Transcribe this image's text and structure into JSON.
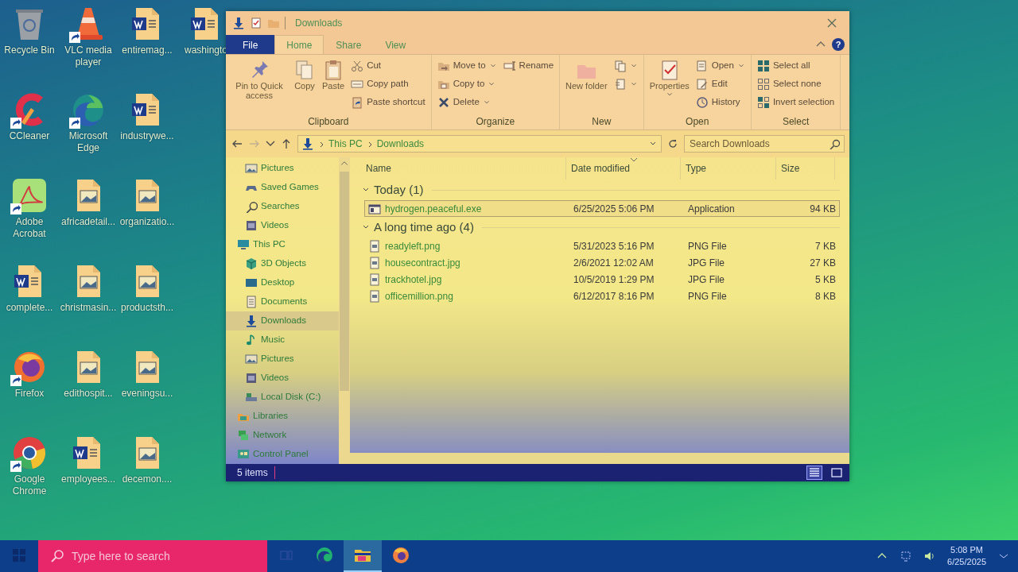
{
  "desktop_icons": [
    {
      "label": "Recycle Bin",
      "kind": "recycle",
      "shortcut": false
    },
    {
      "label": "CCleaner",
      "kind": "ccleaner",
      "shortcut": true
    },
    {
      "label": "Adobe Acrobat",
      "kind": "acrobat",
      "shortcut": true
    },
    {
      "label": "complete...",
      "kind": "word",
      "shortcut": false
    },
    {
      "label": "Firefox",
      "kind": "firefox",
      "shortcut": true
    },
    {
      "label": "Google Chrome",
      "kind": "chrome",
      "shortcut": true
    },
    {
      "label": "VLC media player",
      "kind": "vlc",
      "shortcut": true
    },
    {
      "label": "Microsoft Edge",
      "kind": "edge",
      "shortcut": true
    },
    {
      "label": "africadetail...",
      "kind": "image",
      "shortcut": false
    },
    {
      "label": "christmasin...",
      "kind": "image",
      "shortcut": false
    },
    {
      "label": "edithospit...",
      "kind": "image",
      "shortcut": false
    },
    {
      "label": "employees...",
      "kind": "word",
      "shortcut": false
    },
    {
      "label": "entiremag...",
      "kind": "word",
      "shortcut": false
    },
    {
      "label": "industrywe...",
      "kind": "word",
      "shortcut": false
    },
    {
      "label": "organizatio...",
      "kind": "image",
      "shortcut": false
    },
    {
      "label": "productsth...",
      "kind": "image",
      "shortcut": false
    },
    {
      "label": "eveningsu...",
      "kind": "image",
      "shortcut": false
    },
    {
      "label": "decemon....",
      "kind": "image",
      "shortcut": false
    },
    {
      "label": "washingto",
      "kind": "word",
      "shortcut": false
    }
  ],
  "window": {
    "title": "Downloads",
    "tabs": [
      {
        "label": "File",
        "kind": "file",
        "selected": false
      },
      {
        "label": "Home",
        "kind": "tab",
        "selected": true
      },
      {
        "label": "Share",
        "kind": "tab",
        "selected": false
      },
      {
        "label": "View",
        "kind": "tab",
        "selected": false
      }
    ],
    "help": "?",
    "ribbon": [
      {
        "label": "Clipboard",
        "buttons": [
          {
            "label": "Pin to Quick access",
            "kind": "large",
            "dropdown": false
          },
          {
            "label": "Copy",
            "kind": "large",
            "dropdown": false
          },
          {
            "label": "Paste",
            "kind": "large",
            "dropdown": false
          },
          {
            "label": "Cut",
            "kind": "small",
            "dropdown": false
          },
          {
            "label": "Copy path",
            "kind": "small",
            "dropdown": false
          },
          {
            "label": "Paste shortcut",
            "kind": "small",
            "dropdown": false
          }
        ]
      },
      {
        "label": "Organize",
        "buttons": [
          {
            "label": "Move to",
            "kind": "small",
            "dropdown": true
          },
          {
            "label": "Copy to",
            "kind": "small",
            "dropdown": true
          },
          {
            "label": "Delete",
            "kind": "small",
            "dropdown": true
          },
          {
            "label": "Rename",
            "kind": "small",
            "dropdown": false
          }
        ]
      },
      {
        "label": "New",
        "buttons": [
          {
            "label": "New folder",
            "kind": "large",
            "dropdown": false
          },
          {
            "kind": "small",
            "dropdown": true
          },
          {
            "kind": "small",
            "dropdown": true
          }
        ]
      },
      {
        "label": "Open",
        "buttons": [
          {
            "label": "Properties",
            "kind": "large",
            "dropdown": true
          },
          {
            "label": "Open",
            "kind": "small",
            "dropdown": true
          },
          {
            "label": "Edit",
            "kind": "small",
            "dropdown": false
          },
          {
            "label": "History",
            "kind": "small",
            "dropdown": false
          }
        ]
      },
      {
        "label": "Select",
        "buttons": [
          {
            "label": "Select all",
            "kind": "small",
            "dropdown": false
          },
          {
            "label": "Select none",
            "kind": "small",
            "dropdown": false
          },
          {
            "label": "Invert selection",
            "kind": "small",
            "dropdown": false
          }
        ]
      }
    ],
    "address": {
      "path": [
        "This PC",
        "Downloads"
      ],
      "search_placeholder": "Search Downloads"
    },
    "nav": [
      {
        "children": [
          {
            "label": "Pictures",
            "selected": false
          },
          {
            "label": "Saved Games",
            "selected": false
          },
          {
            "label": "Searches",
            "selected": false
          },
          {
            "label": "Videos",
            "selected": false
          }
        ]
      },
      {
        "label": "This PC",
        "selected": false,
        "children": [
          {
            "label": "3D Objects",
            "selected": false
          },
          {
            "label": "Desktop",
            "selected": false
          },
          {
            "label": "Documents",
            "selected": false
          },
          {
            "label": "Downloads",
            "selected": true
          },
          {
            "label": "Music",
            "selected": false
          },
          {
            "label": "Pictures",
            "selected": false
          },
          {
            "label": "Videos",
            "selected": false
          },
          {
            "label": "Local Disk (C:)",
            "selected": false
          }
        ]
      },
      {
        "label": "Libraries",
        "selected": false
      },
      {
        "label": "Network",
        "selected": false
      },
      {
        "label": "Control Panel",
        "selected": false
      }
    ],
    "columns": [
      "Name",
      "Date modified",
      "Type",
      "Size"
    ],
    "groups": [
      {
        "label": "Today (1)",
        "expanded": true,
        "files": [
          {
            "name": "hydrogen.peaceful.exe",
            "date": "6/25/2025 5:06 PM",
            "type": "Application",
            "size": "94 KB",
            "kind": "exe",
            "selected": true
          }
        ]
      },
      {
        "label": "A long time ago (4)",
        "expanded": true,
        "files": [
          {
            "name": "readyleft.png",
            "date": "5/31/2023 5:16 PM",
            "type": "PNG File",
            "size": "7 KB",
            "kind": "image",
            "selected": false
          },
          {
            "name": "housecontract.jpg",
            "date": "2/6/2021 12:02 AM",
            "type": "JPG File",
            "size": "27 KB",
            "kind": "image",
            "selected": false
          },
          {
            "name": "trackhotel.jpg",
            "date": "10/5/2019 1:29 PM",
            "type": "JPG File",
            "size": "5 KB",
            "kind": "image",
            "selected": false
          },
          {
            "name": "officemillion.png",
            "date": "6/12/2017 8:16 PM",
            "type": "PNG File",
            "size": "8 KB",
            "kind": "image",
            "selected": false
          }
        ]
      }
    ],
    "status": "5 items",
    "views": [
      {
        "kind": "details",
        "selected": true
      },
      {
        "kind": "tiles",
        "selected": false
      }
    ]
  },
  "taskbar": {
    "search_placeholder": "Type here to search",
    "apps": [
      {
        "kind": "edge",
        "active": false
      },
      {
        "kind": "explorer",
        "active": true
      },
      {
        "kind": "firefox",
        "active": false
      }
    ],
    "time": "5:08 PM",
    "date": "6/25/2025"
  }
}
